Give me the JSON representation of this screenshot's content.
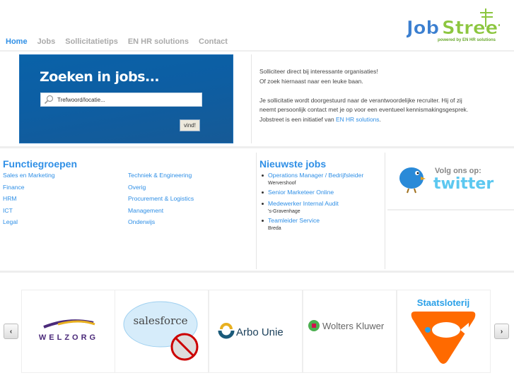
{
  "logo": {
    "name": "JobStreet",
    "tagline": "powered by EN HR solutions"
  },
  "nav": [
    {
      "label": "Home",
      "active": true
    },
    {
      "label": "Jobs"
    },
    {
      "label": "Sollicitatietips"
    },
    {
      "label": "EN HR solutions"
    },
    {
      "label": "Contact"
    }
  ],
  "search": {
    "title": "Zoeken in jobs...",
    "placeholder": "Trefwoord/locatie...",
    "button": "vind!"
  },
  "intro": {
    "line1": "Solliciteer direct bij interessante organisaties!",
    "line2": "Of zoek hiernaast naar een leuke baan.",
    "para2": "Je sollicitatie wordt doorgestuurd naar de verantwoordelijke recruiter. Hij of zij neemt persoonlijk contact met je op voor een eventueel kennismakingsgesprek. Jobstreet is een initiatief van ",
    "link": "EN HR solutions",
    "end": "."
  },
  "functiegroepen": {
    "title": "Functiegroepen",
    "col1": [
      "Sales en Marketing",
      "Finance",
      "HRM",
      "ICT",
      "Legal"
    ],
    "col2": [
      "Techniek & Engineering",
      "Overig",
      "Procurement & Logistics",
      "Management",
      "Onderwijs"
    ]
  },
  "jobs": {
    "title": "Nieuwste jobs",
    "items": [
      {
        "title": "Operations Manager / Bedrijfsleider",
        "location": "Wervershoof"
      },
      {
        "title": "Senior Marketeer Online",
        "location": ""
      },
      {
        "title": "Medewerker Internal Audit",
        "location": "'s-Gravenhage"
      },
      {
        "title": "Teamleider Service",
        "location": "Breda"
      }
    ]
  },
  "twitter": {
    "label": "Volg ons op:",
    "brand": "twitter"
  },
  "partners": [
    "WELZORG",
    "salesforce",
    "Arbo Unie",
    "Wolters Kluwer",
    "Staatsloterij"
  ],
  "colors": {
    "accent": "#2f8fe6",
    "green": "#8cc63f",
    "orange": "#ff6a00"
  }
}
